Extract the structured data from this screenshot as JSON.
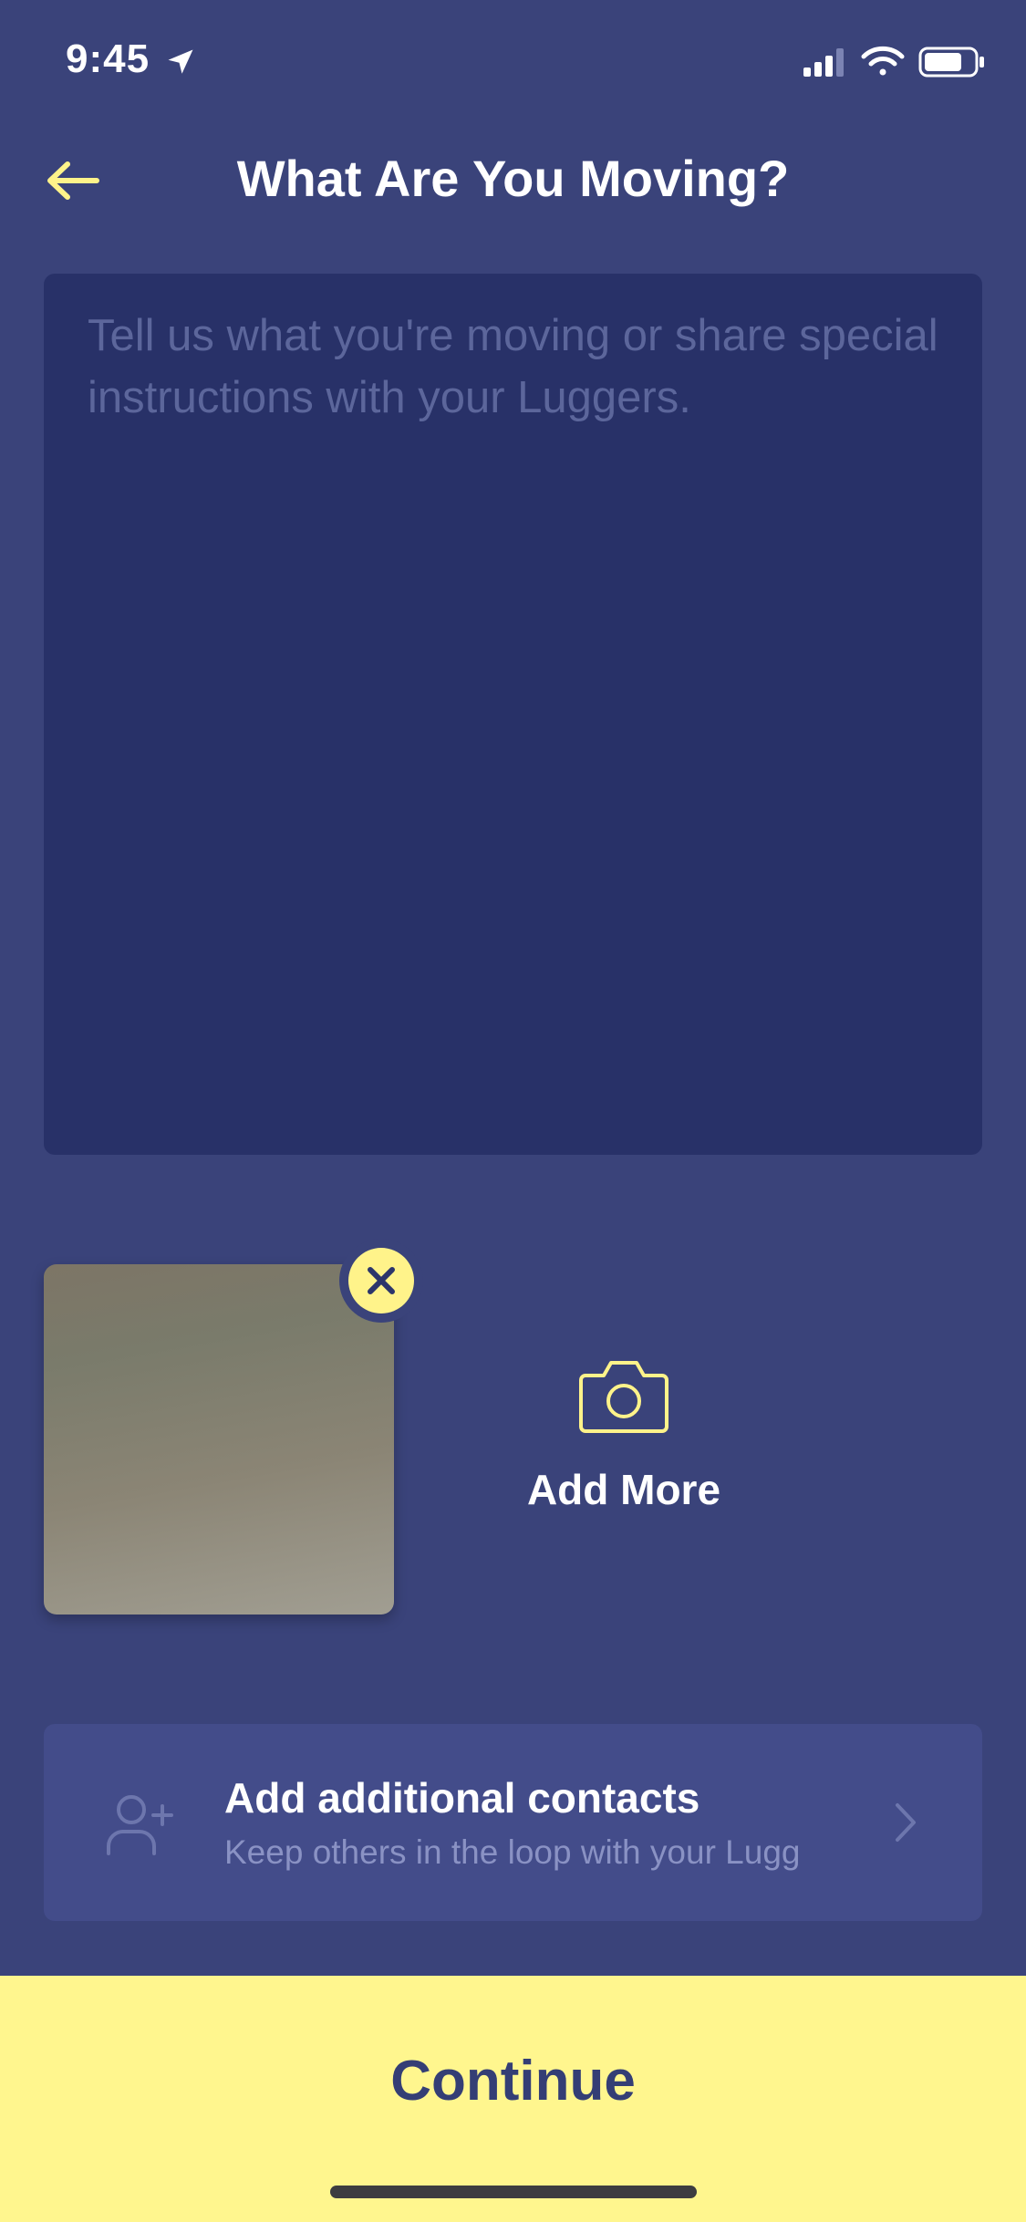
{
  "status_bar": {
    "time": "9:45",
    "icons": [
      "location-arrow-icon",
      "cellular-signal-icon",
      "wifi-icon",
      "battery-icon"
    ]
  },
  "header": {
    "title": "What Are You Moving?",
    "back_icon": "arrow-left-icon"
  },
  "notes": {
    "placeholder": "Tell us what you're moving or share special instructions with your Luggers.",
    "value": ""
  },
  "photos": {
    "remove_icon": "close-icon",
    "add_more_icon": "camera-icon",
    "add_more_label": "Add More"
  },
  "contacts": {
    "icon": "add-user-icon",
    "title": "Add additional contacts",
    "subtitle": "Keep others in the loop with your Lugg",
    "chevron": "chevron-right-icon"
  },
  "footer": {
    "continue_label": "Continue"
  },
  "colors": {
    "background": "#3a437a",
    "input_background": "#283168",
    "card_background": "#434c8a",
    "accent_yellow": "#fff68e",
    "button_text": "#343e75"
  }
}
